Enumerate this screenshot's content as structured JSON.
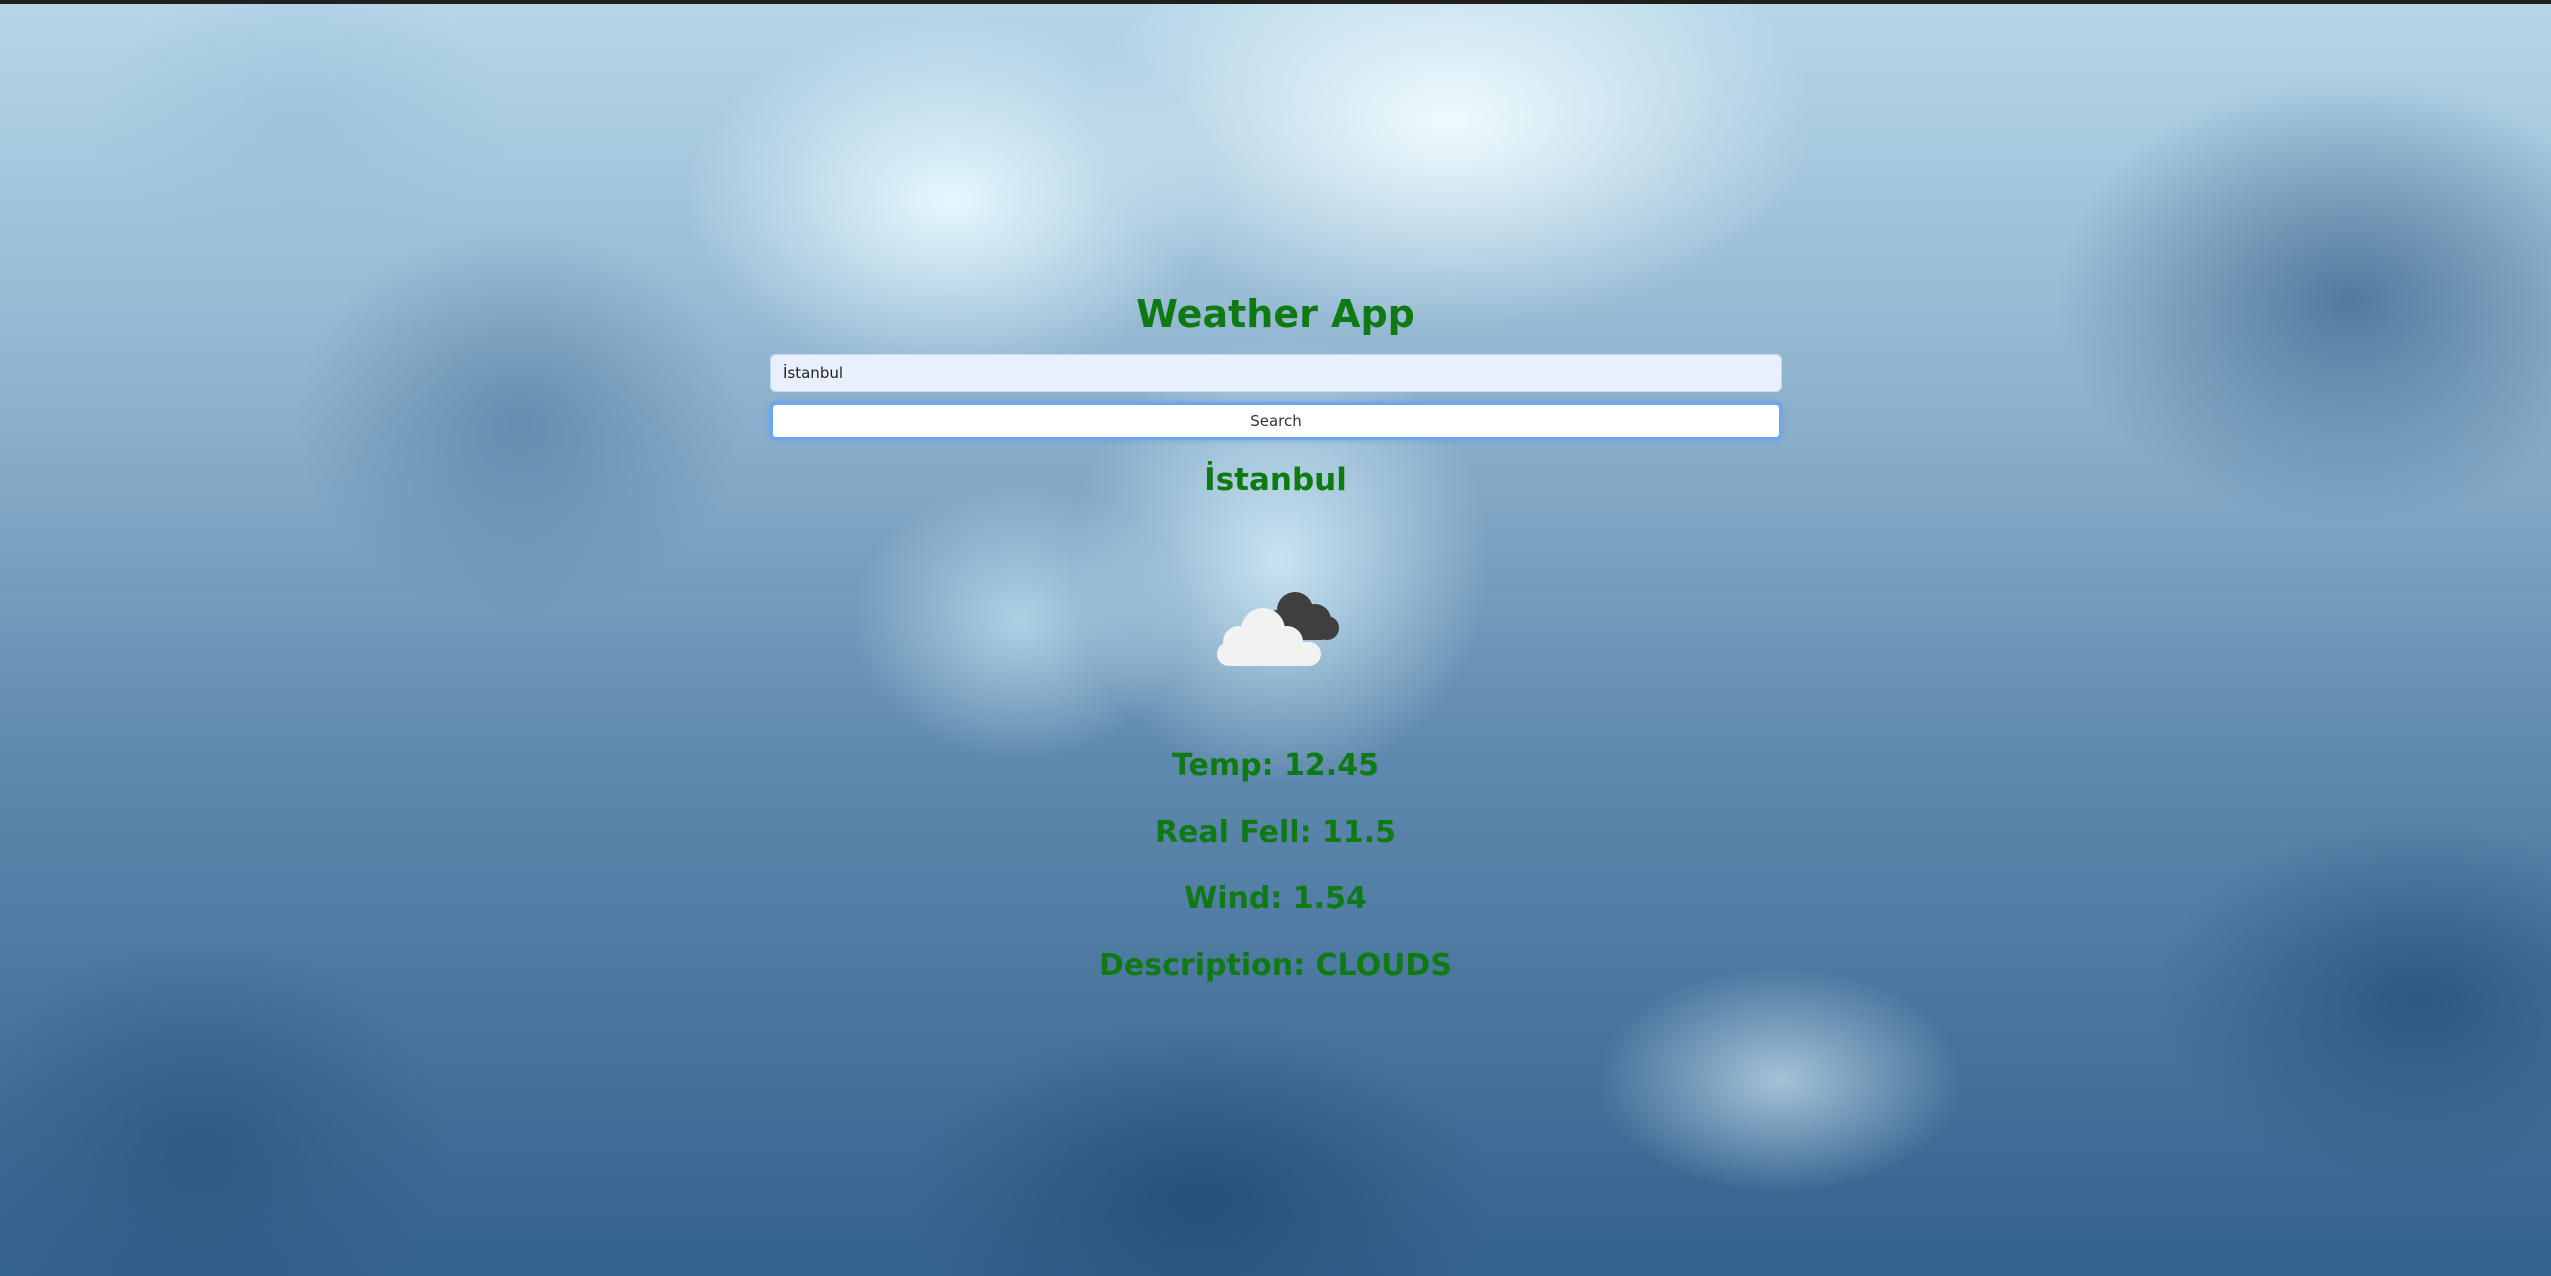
{
  "app": {
    "title": "Weather App"
  },
  "search": {
    "value": "İstanbul",
    "button_label": "Search"
  },
  "weather": {
    "city": "İstanbul",
    "icon": "clouds-icon",
    "temp_text": "Temp: 12.45",
    "feel_text": "Real Fell: 11.5",
    "wind_text": "Wind: 1.54",
    "description_text": "Description: CLOUDS"
  },
  "colors": {
    "text_green": "#0f7a12",
    "input_bg": "#e8f0fe",
    "button_focus_border": "#6ea6ee"
  }
}
